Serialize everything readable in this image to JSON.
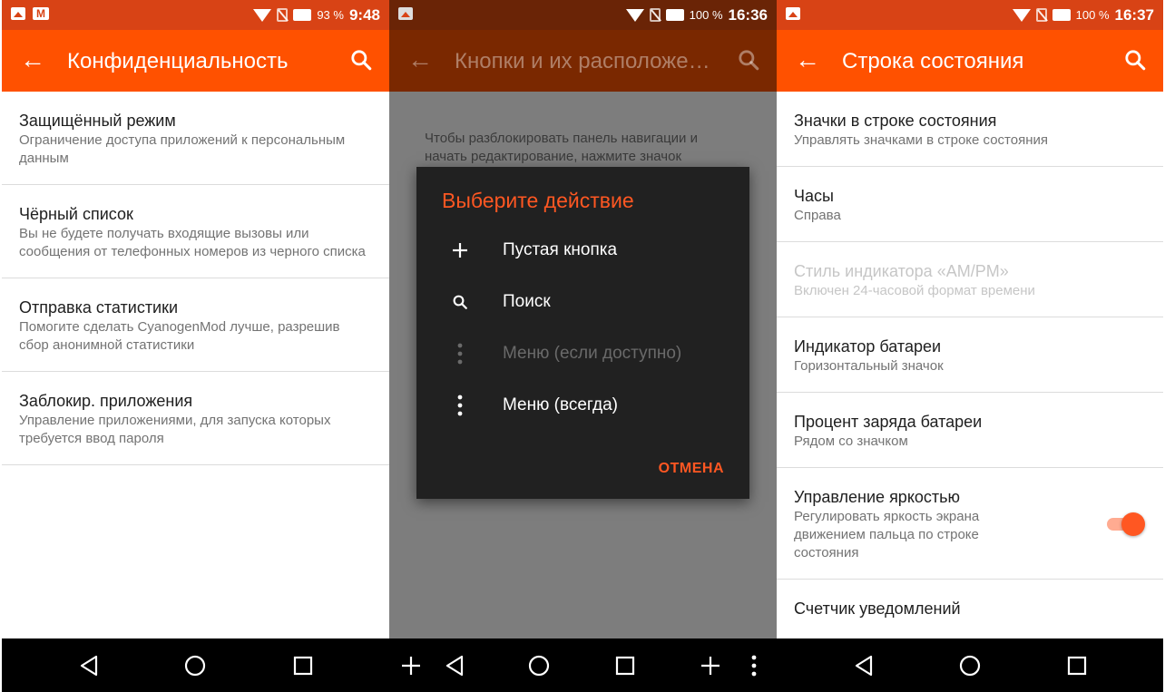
{
  "screens": [
    {
      "status": {
        "battery_pct": "93 %",
        "time": "9:48"
      },
      "title": "Конфиденциальность",
      "items": [
        {
          "title": "Защищённый режим",
          "summary": "Ограничение доступа приложений к персональным данным"
        },
        {
          "title": "Чёрный список",
          "summary": "Вы не будете получать входящие вызовы или сообщения от телефонных номеров из черного списка"
        },
        {
          "title": "Отправка статистики",
          "summary": "Помогите сделать CyanogenMod лучше, разрешив сбор анонимной статистики"
        },
        {
          "title": "Заблокир. приложения",
          "summary": "Управление приложениями, для запуска которых требуется ввод пароля"
        }
      ]
    },
    {
      "status": {
        "battery_pct": "100 %",
        "time": "16:36"
      },
      "title": "Кнопки и их расположе…",
      "background_text": "Чтобы разблокировать панель навигации и начать редактирование, нажмите значок",
      "dialog": {
        "title": "Выберите действие",
        "options": [
          {
            "icon": "plus-icon",
            "label": "Пустая кнопка",
            "enabled": true
          },
          {
            "icon": "search-icon",
            "label": "Поиск",
            "enabled": true
          },
          {
            "icon": "more-vert-icon",
            "label": "Меню (если доступно)",
            "enabled": false
          },
          {
            "icon": "more-vert-icon",
            "label": "Меню (всегда)",
            "enabled": true
          }
        ],
        "cancel_label": "ОТМЕНА"
      }
    },
    {
      "status": {
        "battery_pct": "100 %",
        "time": "16:37"
      },
      "title": "Строка состояния",
      "items": [
        {
          "title": "Значки в строке состояния",
          "summary": "Управлять значками в строке состояния",
          "enabled": true
        },
        {
          "title": "Часы",
          "summary": "Справа",
          "enabled": true
        },
        {
          "title": "Стиль индикатора «AM/PM»",
          "summary": "Включен 24-часовой формат времени",
          "enabled": false
        },
        {
          "title": "Индикатор батареи",
          "summary": "Горизонтальный значок",
          "enabled": true
        },
        {
          "title": "Процент заряда батареи",
          "summary": "Рядом со значком",
          "enabled": true
        },
        {
          "title": "Управление яркостью",
          "summary": "Регулировать яркость экрана движением пальца по строке состояния",
          "enabled": true,
          "toggle_on": true
        },
        {
          "title": "Счетчик уведомлений",
          "summary": "",
          "enabled": true
        }
      ]
    }
  ],
  "colors": {
    "accent": "#ff5722",
    "toolbar": "#ff5100",
    "statusbar": "#d84315"
  }
}
